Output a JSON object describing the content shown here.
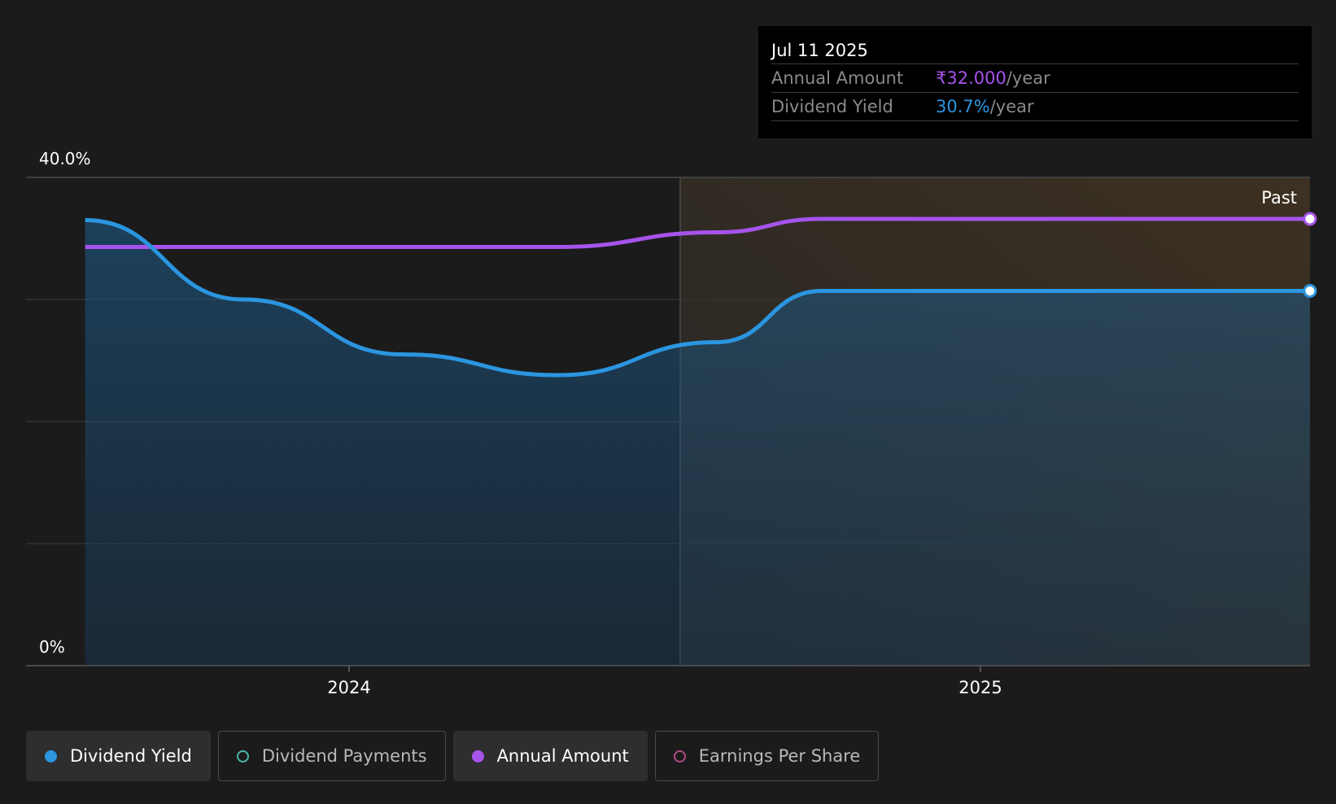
{
  "chart_data": {
    "type": "line",
    "x_ticks": [
      "2024",
      "2025"
    ],
    "y_ticks": [
      "40.0%",
      "0%"
    ],
    "ylim": [
      0,
      40
    ],
    "grid": true,
    "past_label": "Past",
    "series": [
      {
        "name": "Dividend Yield",
        "color": "#2b95e0",
        "points": [
          [
            "2023-08-01",
            36.5
          ],
          [
            "2023-11-01",
            30.0
          ],
          [
            "2024-02-01",
            25.5
          ],
          [
            "2024-05-01",
            23.8
          ],
          [
            "2024-08-01",
            26.5
          ],
          [
            "2024-10-01",
            30.7
          ],
          [
            "2024-12-01",
            30.7
          ],
          [
            "2025-07-11",
            30.7
          ]
        ]
      },
      {
        "name": "Annual Amount",
        "color": "#a653eb",
        "points": [
          [
            "2023-08-01",
            34.3
          ],
          [
            "2024-05-01",
            34.3
          ],
          [
            "2024-08-01",
            35.5
          ],
          [
            "2024-10-01",
            36.6
          ],
          [
            "2025-07-11",
            36.6
          ]
        ]
      }
    ]
  },
  "tooltip": {
    "date": "Jul 11 2025",
    "rows": [
      {
        "label": "Annual Amount",
        "value": "₹32.000",
        "unit": "/year",
        "color": "#a653eb"
      },
      {
        "label": "Dividend Yield",
        "value": "30.7%",
        "unit": "/year",
        "color": "#2b95e0"
      }
    ]
  },
  "legend": [
    {
      "label": "Dividend Yield",
      "color": "#2b95e0",
      "style": "filled",
      "active": true
    },
    {
      "label": "Dividend Payments",
      "color": "#4bb6a8",
      "style": "hollow",
      "active": false
    },
    {
      "label": "Annual Amount",
      "color": "#a653eb",
      "style": "filled",
      "active": true
    },
    {
      "label": "Earnings Per Share",
      "color": "#b04a86",
      "style": "hollow",
      "active": false
    }
  ]
}
